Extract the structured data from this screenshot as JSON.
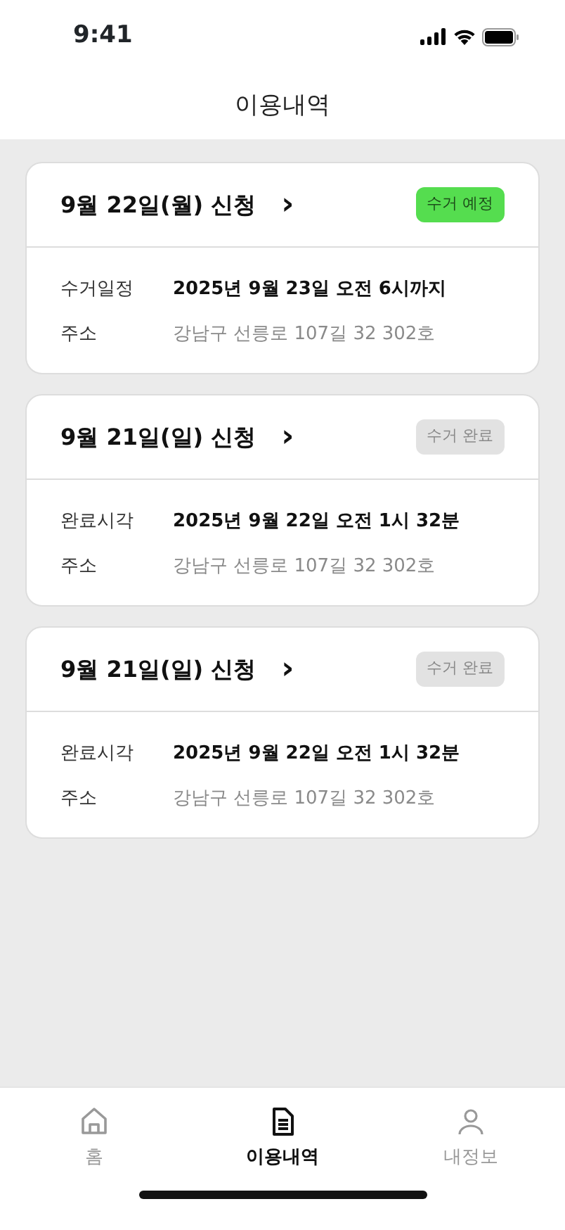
{
  "status_bar": {
    "time": "9:41"
  },
  "header": {
    "title": "이용내역"
  },
  "orders": [
    {
      "title": "9월 22일(월) 신청",
      "chevron": "›",
      "status": {
        "kind": "scheduled",
        "label": "수거 예정"
      },
      "rows": [
        {
          "label": "수거일정",
          "value": "2025년 9월 23일 오전 6시까지",
          "kind": "strong"
        },
        {
          "label": "주소",
          "value": "강남구 선릉로 107길 32 302호",
          "kind": "muted"
        }
      ]
    },
    {
      "title": "9월 21일(일) 신청",
      "chevron": "›",
      "status": {
        "kind": "done",
        "label": "수거 완료"
      },
      "rows": [
        {
          "label": "완료시각",
          "value": "2025년 9월 22일 오전 1시 32분",
          "kind": "strong"
        },
        {
          "label": "주소",
          "value": "강남구 선릉로 107길 32 302호",
          "kind": "muted"
        }
      ]
    },
    {
      "title": "9월 21일(일) 신청",
      "chevron": "›",
      "status": {
        "kind": "done",
        "label": "수거 완료"
      },
      "rows": [
        {
          "label": "완료시각",
          "value": "2025년 9월 22일 오전 1시 32분",
          "kind": "strong"
        },
        {
          "label": "주소",
          "value": "강남구 선릉로 107길 32 302호",
          "kind": "muted"
        }
      ]
    }
  ],
  "tab_bar": [
    {
      "kind": "home",
      "label": "홈",
      "selected": false
    },
    {
      "kind": "document",
      "label": "이용내역",
      "selected": true
    },
    {
      "kind": "person",
      "label": "내정보",
      "selected": false
    }
  ]
}
